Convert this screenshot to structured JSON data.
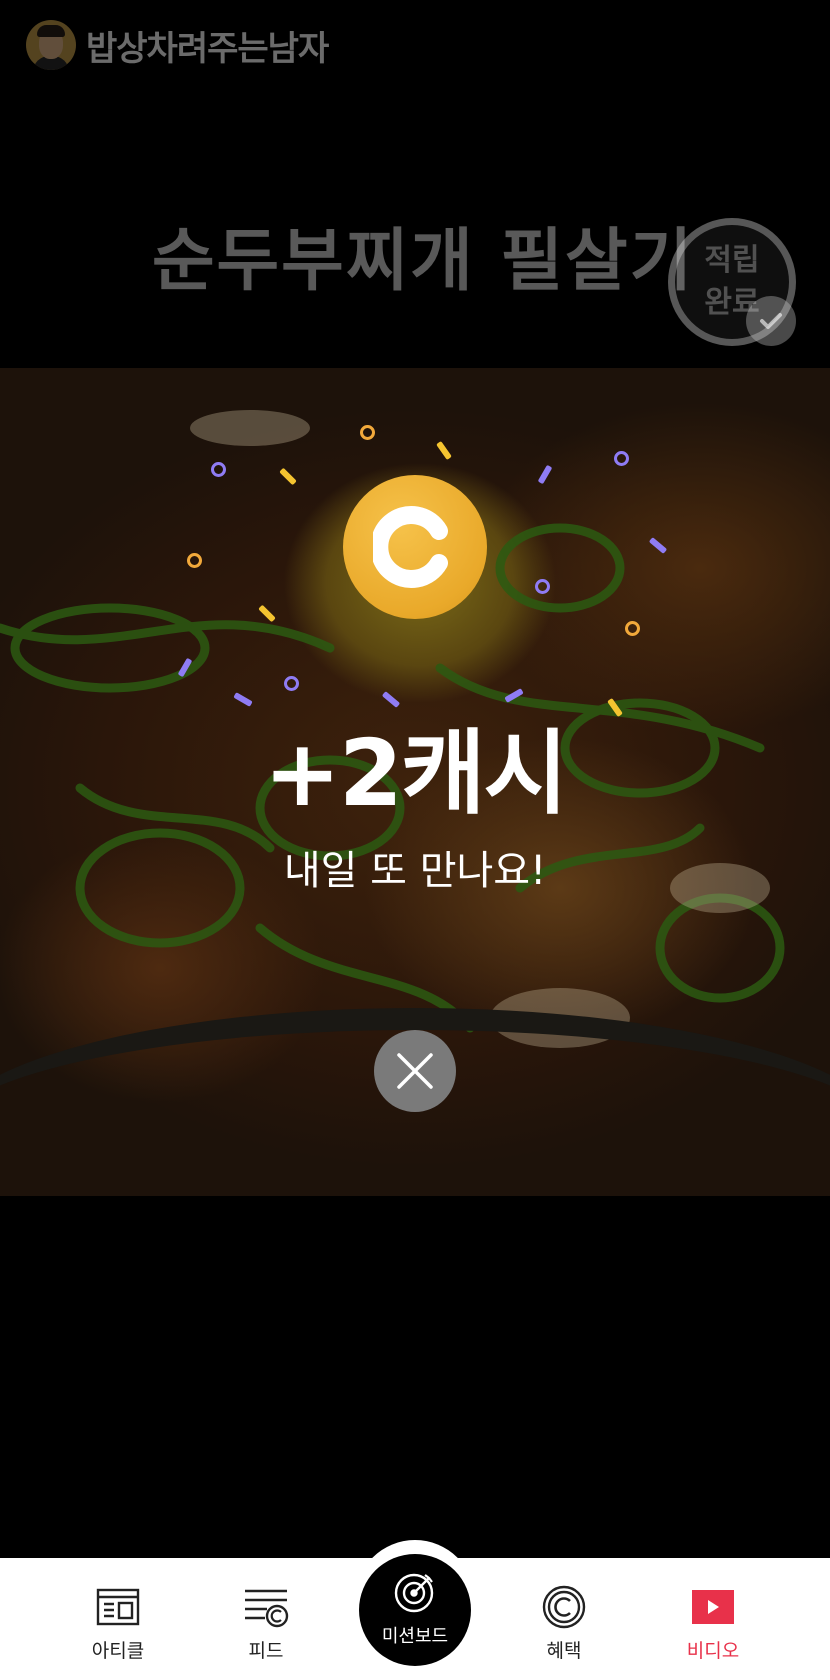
{
  "channel": {
    "name": "밥상차려주는남자"
  },
  "video": {
    "title": "순두부찌개 필살기",
    "done_badge": {
      "line1": "적립",
      "line2": "완료"
    }
  },
  "reward": {
    "amount": "+2캐시",
    "message": "내일 또 만나요!",
    "coin_icon": "c-coin-icon",
    "confetti_colors": {
      "purple": "#8f7cf4",
      "yellow": "#f4c430",
      "orange": "#f2a93b"
    }
  },
  "bottom_nav": {
    "items": [
      {
        "label": "아티클",
        "icon": "article-icon"
      },
      {
        "label": "피드",
        "icon": "feed-icon"
      },
      {
        "label": "미션보드",
        "icon": "target-icon"
      },
      {
        "label": "혜택",
        "icon": "cash-coin-icon"
      },
      {
        "label": "비디오",
        "icon": "play-icon"
      }
    ],
    "active_index": 4,
    "active_color": "#e8314a"
  }
}
